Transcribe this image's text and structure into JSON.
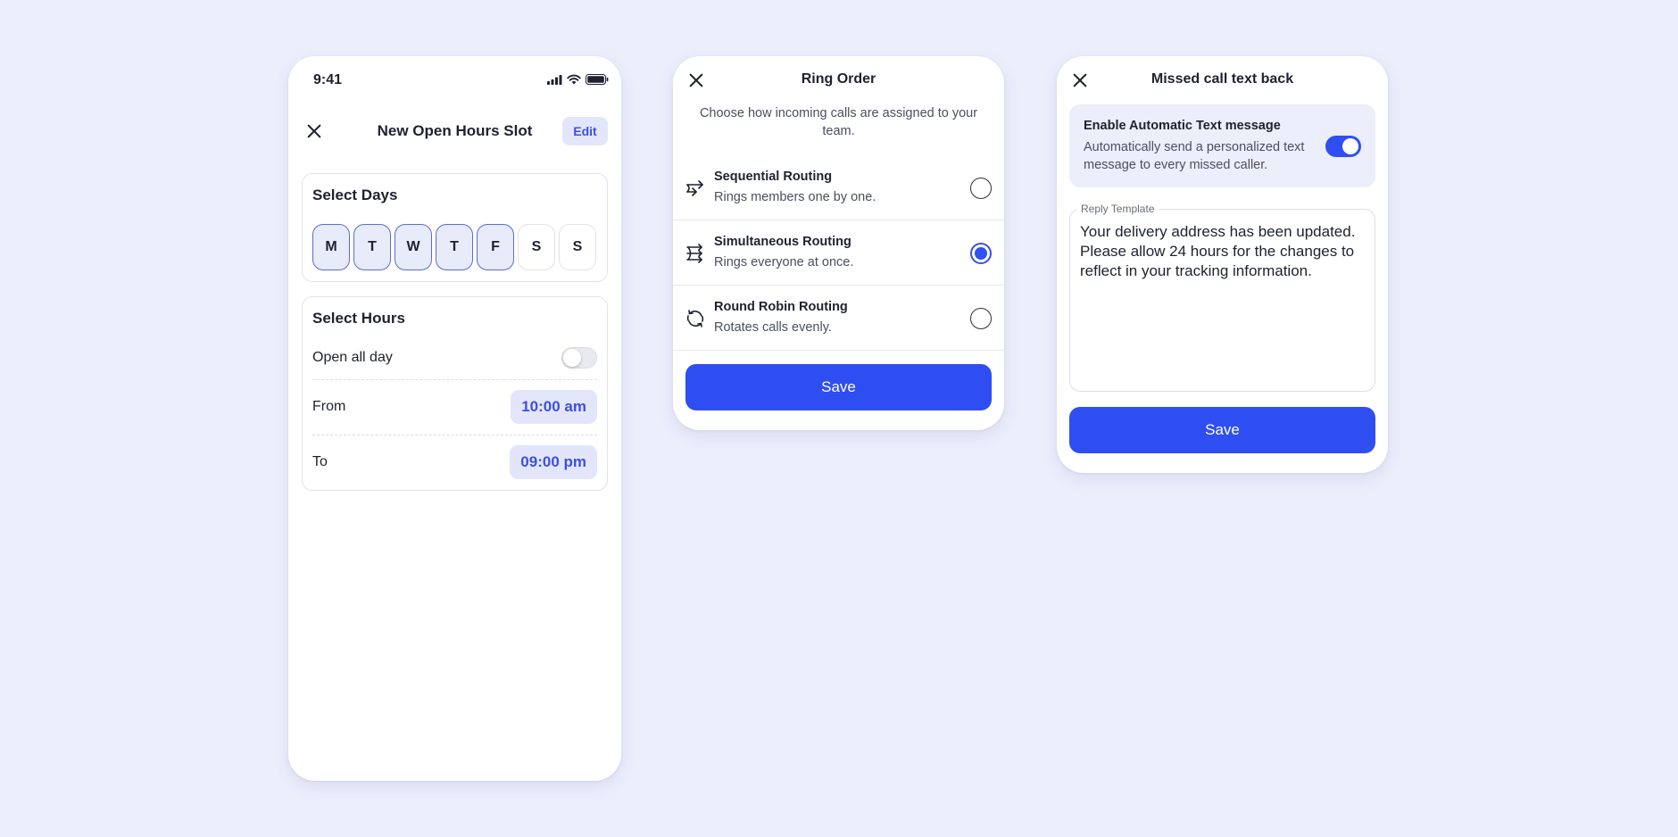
{
  "open_hours": {
    "status_time": "9:41",
    "title": "New Open Hours Slot",
    "edit_label": "Edit",
    "days_title": "Select  Days",
    "days": [
      {
        "label": "M",
        "selected": true
      },
      {
        "label": "T",
        "selected": true
      },
      {
        "label": "W",
        "selected": true
      },
      {
        "label": "T",
        "selected": true
      },
      {
        "label": "F",
        "selected": true
      },
      {
        "label": "S",
        "selected": false
      },
      {
        "label": "S",
        "selected": false
      }
    ],
    "hours_title": "Select  Hours",
    "open_all_day_label": "Open all day",
    "open_all_day": false,
    "from_label": "From",
    "from_value": "10:00 am",
    "to_label": "To",
    "to_value": "09:00 pm"
  },
  "ring_order": {
    "title": "Ring Order",
    "description": "Choose how incoming calls are assigned to your team.",
    "options": [
      {
        "name": "Sequential Routing",
        "subtitle": "Rings members one by one.",
        "icon": "sequential-arrows-icon",
        "selected": false
      },
      {
        "name": "Simultaneous Routing",
        "subtitle": "Rings everyone at once.",
        "icon": "simultaneous-arrows-icon",
        "selected": true
      },
      {
        "name": "Round Robin Routing",
        "subtitle": "Rotates calls evenly.",
        "icon": "round-robin-icon",
        "selected": false
      }
    ],
    "save_label": "Save"
  },
  "missed_call": {
    "title": "Missed call text back",
    "auto_title": "Enable Automatic Text message",
    "auto_description": "Automatically send a personalized text message to every missed caller.",
    "auto_enabled": true,
    "template_label": "Reply Template",
    "template_text": "Your delivery address has been updated. Please allow 24 hours for the changes to reflect in your tracking information.",
    "save_label": "Save"
  },
  "colors": {
    "background": "#ECEEFC",
    "accent": "#2F4EF2",
    "accent_soft": "#E3E6FA"
  }
}
